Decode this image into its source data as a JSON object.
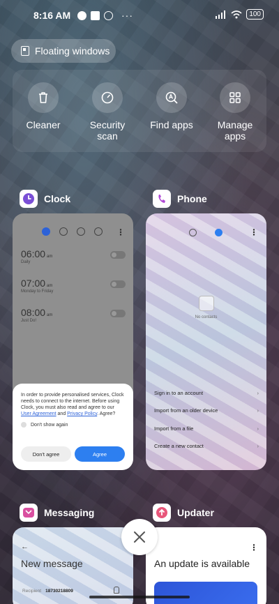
{
  "status_bar": {
    "time": "8:16 AM",
    "battery": "100",
    "extra_icons": [
      "moon-icon",
      "screenshot-icon",
      "notification-icon",
      "more-icon"
    ]
  },
  "floating": {
    "label": "Floating windows"
  },
  "tools": [
    {
      "icon": "trash-icon",
      "label": "Cleaner"
    },
    {
      "icon": "shield-scan-icon",
      "label": "Security\nscan"
    },
    {
      "icon": "find-apps-icon",
      "label": "Find apps"
    },
    {
      "icon": "grid-icon",
      "label": "Manage\napps"
    }
  ],
  "apps": {
    "clock": {
      "name": "Clock",
      "alarms": [
        {
          "time": "06:00",
          "ampm": "am",
          "sub": "Daily"
        },
        {
          "time": "07:00",
          "ampm": "am",
          "sub": "Monday to Friday"
        },
        {
          "time": "08:00",
          "ampm": "am",
          "sub": "Just Do!"
        }
      ],
      "dialog": {
        "message_pre": "In order to provide personalised services, Clock needs to connect to the internet. Before using Clock, you must also read and agree to our ",
        "link1": "User Agreement",
        "and": " and ",
        "link2": "Privacy Policy",
        "message_post": ". Agree?",
        "checkbox": "Don't show again",
        "decline": "Don't agree",
        "accept": "Agree"
      }
    },
    "phone": {
      "name": "Phone",
      "empty": "No contacts",
      "options": [
        "Sign in to an account",
        "Import from an older device",
        "Import from a file",
        "Create a new contact"
      ]
    },
    "messaging": {
      "name": "Messaging",
      "title": "New message",
      "recipient_label": "Recipient",
      "recipient_value": "18730218809"
    },
    "updater": {
      "name": "Updater",
      "title": "An update is available"
    }
  }
}
